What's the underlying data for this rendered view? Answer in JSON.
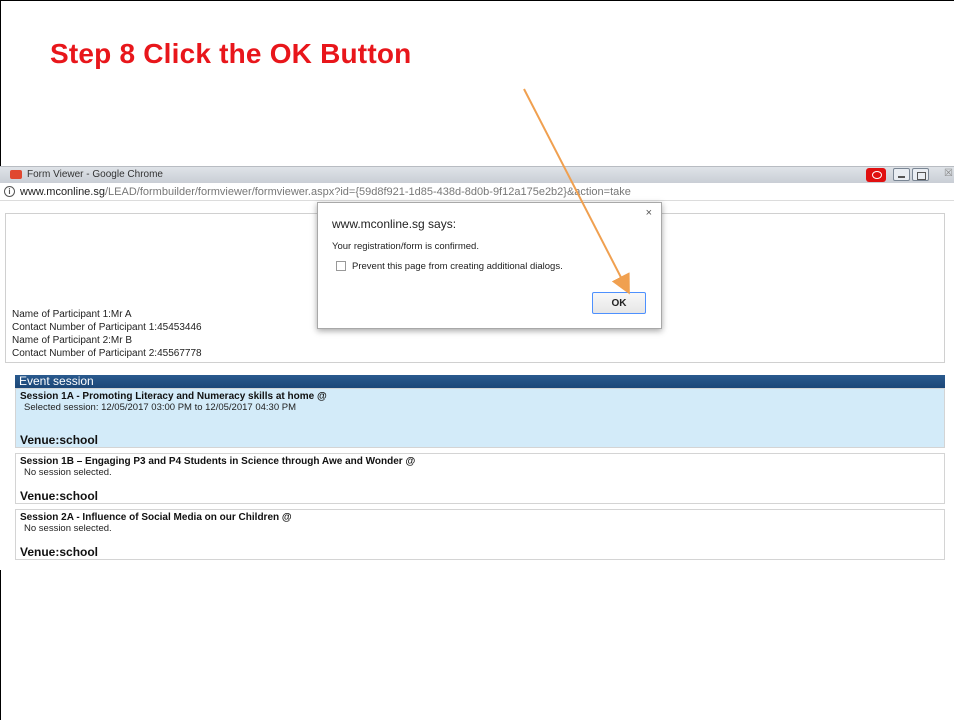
{
  "slide": {
    "title": "Step 8 Click the OK Button"
  },
  "window": {
    "title": "Form Viewer - Google Chrome",
    "url_host": "www.mconline.sg",
    "url_path": "/LEAD/formbuilder/formviewer/formviewer.aspx?id={59d8f921-1d85-438d-8d0b-9f12a175e2b2}&action=take",
    "close_glyph": "☒"
  },
  "participants": [
    "Name of Participant 1:Mr A",
    "Contact Number of Participant 1:45453446",
    "Name of Participant 2:Mr B",
    "Contact Number of Participant 2:45567778"
  ],
  "event_section": {
    "header": "Event session",
    "sessions": [
      {
        "title": "Session 1A - Promoting Literacy and Numeracy skills at home @",
        "status": "Selected session: 12/05/2017 03:00 PM to 12/05/2017 04:30 PM",
        "venue": "Venue:school"
      },
      {
        "title": "Session 1B – Engaging P3 and P4 Students in Science through Awe and Wonder @",
        "status": "No session selected.",
        "venue": "Venue:school"
      },
      {
        "title": "Session 2A - Influence of Social Media on our Children @",
        "status": "No session selected.",
        "venue": "Venue:school"
      }
    ]
  },
  "dialog": {
    "host": "www.mconline.sg says:",
    "message": "Your registration/form is confirmed.",
    "checkbox_label": "Prevent this page from creating additional dialogs.",
    "ok_label": "OK",
    "close_glyph": "×"
  },
  "colors": {
    "title_red": "#e8161b",
    "arrow_orange": "#f0a050",
    "header_blue": "#1c4777",
    "selected_bg": "#d3ebf9"
  }
}
